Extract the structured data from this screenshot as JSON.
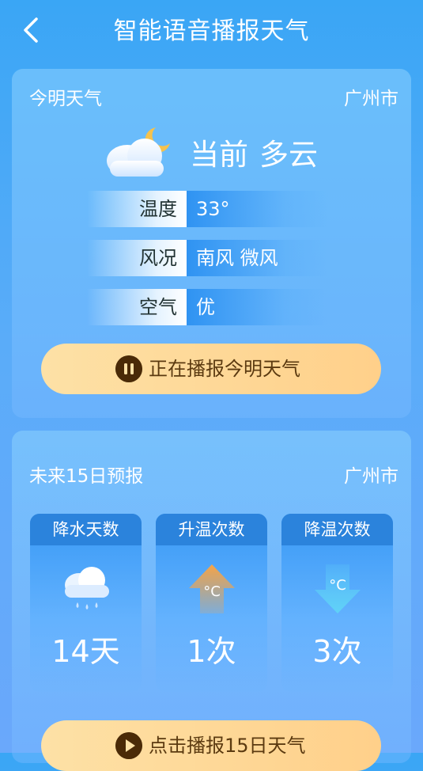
{
  "header": {
    "title": "智能语音播报天气"
  },
  "today": {
    "title": "今明天气",
    "city": "广州市",
    "current_label": "当前",
    "current_condition": "多云",
    "rows": [
      {
        "label": "温度",
        "value": "33°"
      },
      {
        "label": "风况",
        "value": "南风 微风"
      },
      {
        "label": "空气",
        "value": "优"
      }
    ],
    "button_label": "正在播报今明天气"
  },
  "forecast": {
    "title": "未来15日预报",
    "city": "广州市",
    "stats": [
      {
        "label": "降水天数",
        "value": "14天",
        "icon": "rain-cloud-icon"
      },
      {
        "label": "升温次数",
        "value": "1次",
        "icon": "temperature-up-icon",
        "unit": "°C"
      },
      {
        "label": "降温次数",
        "value": "3次",
        "icon": "temperature-down-icon",
        "unit": "°C"
      }
    ],
    "button_label": "点击播报15日天气"
  },
  "colors": {
    "accent_blue": "#2f93f2",
    "button_gold": "#ffd08a",
    "up_arrow": "#f6a24a",
    "down_arrow": "#5fd2f7"
  }
}
